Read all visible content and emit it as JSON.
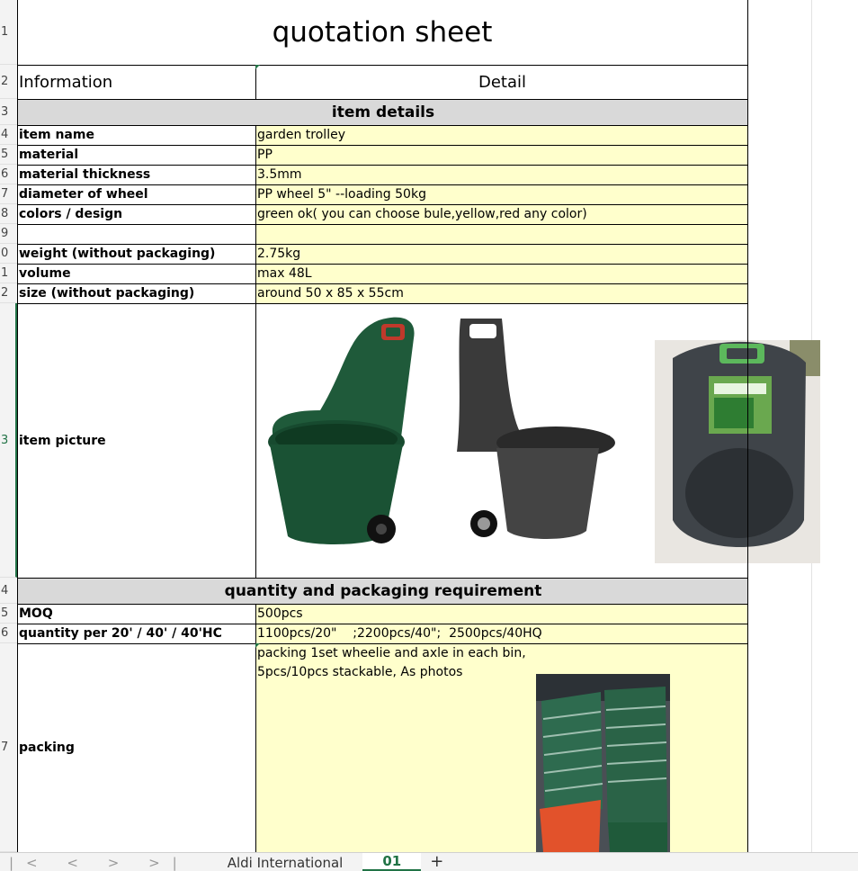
{
  "sheet": {
    "title": "quotation sheet",
    "col_a_header": "Information",
    "col_b_header": "Detail",
    "section_item": "item details",
    "section_qty": "quantity and packaging requirement",
    "rows": {
      "item_name": {
        "label": "item name",
        "value": "garden trolley"
      },
      "material": {
        "label": "material",
        "value": "PP"
      },
      "thickness": {
        "label": "material thickness",
        "value": "3.5mm"
      },
      "wheel": {
        "label": "diameter of wheel",
        "value": "PP wheel 5\" --loading 50kg"
      },
      "colors": {
        "label": "colors / design",
        "value": "green ok( you can choose bule,yellow,red any color)"
      },
      "weight": {
        "label": "weight (without packaging)",
        "value": "2.75kg"
      },
      "volume": {
        "label": "volume",
        "value": "max 48L"
      },
      "size": {
        "label": "size (without packaging)",
        "value": "around 50 x 85 x 55cm"
      },
      "picture": {
        "label": "item picture"
      },
      "moq": {
        "label": "MOQ",
        "value": "500pcs"
      },
      "qty": {
        "label": "quantity per 20' / 40' / 40'HC",
        "value": "1100pcs/20\"    ;2200pcs/40\";  2500pcs/40HQ"
      },
      "packing": {
        "label": "packing",
        "line1": "packing 1set wheelie and axle in each bin,",
        "line2": "5pcs/10pcs stackable, As photos"
      }
    },
    "row_numbers": [
      "1",
      "2",
      "3",
      "4",
      "5",
      "6",
      "7",
      "8",
      "9",
      "0",
      "1",
      "2",
      "3",
      "4",
      "5",
      "6",
      "7"
    ]
  },
  "tabs": {
    "nav": "|< < > >|",
    "sheet1": "Aldi International",
    "sheet2": "01",
    "add": "+"
  }
}
